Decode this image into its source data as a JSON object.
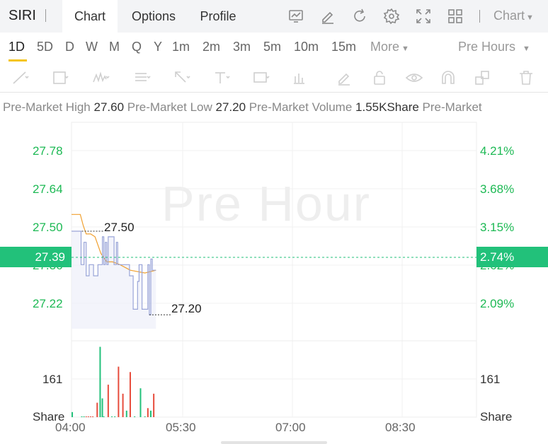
{
  "header": {
    "ticker": "SIRI",
    "tabs": [
      {
        "label": "Chart",
        "active": true
      },
      {
        "label": "Options",
        "active": false
      },
      {
        "label": "Profile",
        "active": false
      }
    ],
    "toolbar_icons": [
      "indicator-icon",
      "draw-edit-icon",
      "refresh-icon",
      "settings-icon",
      "fullscreen-icon",
      "layout-grid-icon"
    ],
    "chart_type_label": "Chart"
  },
  "periods": {
    "items": [
      "1D",
      "5D",
      "D",
      "W",
      "M",
      "Q",
      "Y",
      "1m",
      "2m",
      "3m",
      "5m",
      "10m",
      "15m"
    ],
    "active": "1D",
    "more_label": "More",
    "session_label": "Pre Hours"
  },
  "stats": {
    "high_label": "Pre-Market High",
    "high_value": "27.60",
    "low_label": "Pre-Market Low",
    "low_value": "27.20",
    "volume_label": "Pre-Market Volume",
    "volume_value": "1.55KShare",
    "trailing_label": "Pre-Market"
  },
  "colors": {
    "up": "#22c17a",
    "down": "#e74c3c",
    "price_line": "#9aa5d8",
    "avg_line": "#f0a030",
    "highlight": "#f5c518"
  },
  "chart_data": {
    "type": "line",
    "watermark": "Pre Hour",
    "x_ticks": [
      "04:00",
      "05:30",
      "07:00",
      "08:30"
    ],
    "price_axis_left": [
      "27.78",
      "27.64",
      "27.50",
      "27.36",
      "27.22"
    ],
    "price_axis_right": [
      "4.21%",
      "3.68%",
      "3.15%",
      "2.62%",
      "2.09%"
    ],
    "current_price": "27.39",
    "current_change": "2.74%",
    "high_marker": "27.50",
    "low_marker": "27.20",
    "ylim": [
      27.15,
      27.86
    ],
    "price_series": [
      {
        "t": 0,
        "p": 27.5
      },
      {
        "t": 13,
        "p": 27.5
      },
      {
        "t": 13,
        "p": 27.38
      },
      {
        "t": 17,
        "p": 27.38
      },
      {
        "t": 17,
        "p": 27.46
      },
      {
        "t": 20,
        "p": 27.46
      },
      {
        "t": 20,
        "p": 27.34
      },
      {
        "t": 24,
        "p": 27.34
      },
      {
        "t": 24,
        "p": 27.38
      },
      {
        "t": 30,
        "p": 27.38
      },
      {
        "t": 30,
        "p": 27.34
      },
      {
        "t": 36,
        "p": 27.34
      },
      {
        "t": 36,
        "p": 27.38
      },
      {
        "t": 42,
        "p": 27.38
      },
      {
        "t": 42,
        "p": 27.48
      },
      {
        "t": 44,
        "p": 27.48
      },
      {
        "t": 44,
        "p": 27.38
      },
      {
        "t": 46,
        "p": 27.38
      },
      {
        "t": 46,
        "p": 27.46
      },
      {
        "t": 48,
        "p": 27.46
      },
      {
        "t": 48,
        "p": 27.38
      },
      {
        "t": 50,
        "p": 27.38
      },
      {
        "t": 50,
        "p": 27.48
      },
      {
        "t": 58,
        "p": 27.48
      },
      {
        "t": 58,
        "p": 27.38
      },
      {
        "t": 61,
        "p": 27.38
      },
      {
        "t": 61,
        "p": 27.46
      },
      {
        "t": 63,
        "p": 27.46
      },
      {
        "t": 63,
        "p": 27.38
      },
      {
        "t": 79,
        "p": 27.38
      },
      {
        "t": 79,
        "p": 27.34
      },
      {
        "t": 84,
        "p": 27.34
      },
      {
        "t": 84,
        "p": 27.22
      },
      {
        "t": 90,
        "p": 27.22
      },
      {
        "t": 90,
        "p": 27.32
      },
      {
        "t": 92,
        "p": 27.32
      },
      {
        "t": 92,
        "p": 27.38
      },
      {
        "t": 96,
        "p": 27.38
      },
      {
        "t": 96,
        "p": 27.22
      },
      {
        "t": 104,
        "p": 27.22
      },
      {
        "t": 104,
        "p": 27.38
      },
      {
        "t": 106,
        "p": 27.38
      },
      {
        "t": 106,
        "p": 27.2
      },
      {
        "t": 108,
        "p": 27.2
      },
      {
        "t": 108,
        "p": 27.4
      },
      {
        "t": 110,
        "p": 27.4
      },
      {
        "t": 110,
        "p": 27.36
      },
      {
        "t": 115,
        "p": 27.36
      }
    ],
    "avg_series": [
      {
        "t": 0,
        "p": 27.56
      },
      {
        "t": 12,
        "p": 27.56
      },
      {
        "t": 16,
        "p": 27.52
      },
      {
        "t": 20,
        "p": 27.49
      },
      {
        "t": 26,
        "p": 27.49
      },
      {
        "t": 32,
        "p": 27.48
      },
      {
        "t": 40,
        "p": 27.42
      },
      {
        "t": 48,
        "p": 27.39
      },
      {
        "t": 56,
        "p": 27.39
      },
      {
        "t": 66,
        "p": 27.38
      },
      {
        "t": 80,
        "p": 27.36
      },
      {
        "t": 100,
        "p": 27.35
      },
      {
        "t": 115,
        "p": 27.36
      }
    ],
    "volume_axis": {
      "label": "161",
      "unit": "Share",
      "max": 200
    },
    "volume_bars": [
      {
        "t": 1,
        "v": 14,
        "dir": "up"
      },
      {
        "t": 14,
        "v": 2,
        "dir": "up"
      },
      {
        "t": 17,
        "v": 2,
        "dir": "up"
      },
      {
        "t": 20,
        "v": 2,
        "dir": "down"
      },
      {
        "t": 23,
        "v": 2,
        "dir": "down"
      },
      {
        "t": 26,
        "v": 2,
        "dir": "down"
      },
      {
        "t": 29,
        "v": 2,
        "dir": "down"
      },
      {
        "t": 35,
        "v": 40,
        "dir": "down"
      },
      {
        "t": 39,
        "v": 195,
        "dir": "up"
      },
      {
        "t": 42,
        "v": 52,
        "dir": "up"
      },
      {
        "t": 44,
        "v": 2,
        "dir": "up"
      },
      {
        "t": 50,
        "v": 90,
        "dir": "down"
      },
      {
        "t": 55,
        "v": 2,
        "dir": "up"
      },
      {
        "t": 59,
        "v": 2,
        "dir": "up"
      },
      {
        "t": 64,
        "v": 140,
        "dir": "down"
      },
      {
        "t": 70,
        "v": 65,
        "dir": "down"
      },
      {
        "t": 75,
        "v": 18,
        "dir": "up"
      },
      {
        "t": 80,
        "v": 125,
        "dir": "down"
      },
      {
        "t": 86,
        "v": 2,
        "dir": "up"
      },
      {
        "t": 94,
        "v": 80,
        "dir": "up"
      },
      {
        "t": 100,
        "v": 2,
        "dir": "up"
      },
      {
        "t": 104,
        "v": 25,
        "dir": "down"
      },
      {
        "t": 108,
        "v": 18,
        "dir": "up"
      },
      {
        "t": 112,
        "v": 65,
        "dir": "down"
      }
    ]
  }
}
